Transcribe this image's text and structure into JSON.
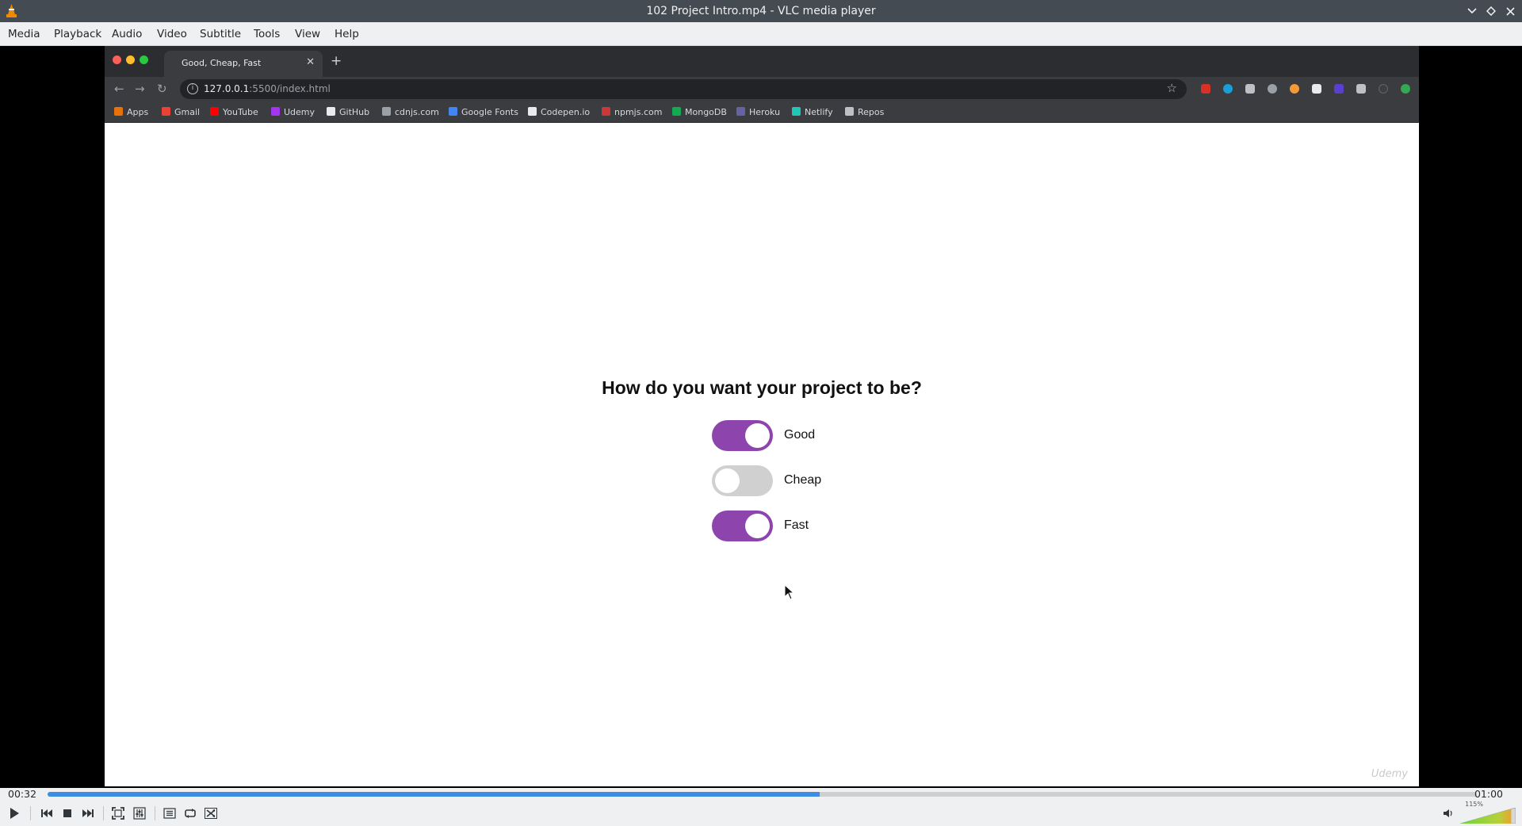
{
  "window": {
    "title": "102 Project Intro.mp4 - VLC media player",
    "app_icon": "vlc-cone-icon",
    "controls": [
      "chevron-down-icon",
      "restore-icon",
      "close-icon"
    ]
  },
  "menubar": {
    "items": [
      "Media",
      "Playback",
      "Audio",
      "Video",
      "Subtitle",
      "Tools",
      "View",
      "Help"
    ]
  },
  "browser": {
    "tab_title": "Good, Cheap, Fast",
    "url_host": "127.0.0.1",
    "url_rest": ":5500/index.html",
    "bookmarks": [
      {
        "label": "Apps",
        "color": "#e8710a"
      },
      {
        "label": "Gmail",
        "color": "#ea4335"
      },
      {
        "label": "YouTube",
        "color": "#ff0000"
      },
      {
        "label": "Udemy",
        "color": "#a435f0"
      },
      {
        "label": "GitHub",
        "color": "#e8eaed"
      },
      {
        "label": "cdnjs.com",
        "color": "#9aa0a6"
      },
      {
        "label": "Google Fonts",
        "color": "#4285f4"
      },
      {
        "label": "Codepen.io",
        "color": "#e8eaed"
      },
      {
        "label": "npmjs.com",
        "color": "#cb3837"
      },
      {
        "label": "MongoDB",
        "color": "#13aa52"
      },
      {
        "label": "Heroku",
        "color": "#6762a6"
      },
      {
        "label": "Netlify",
        "color": "#20c6b7"
      },
      {
        "label": "Repos",
        "color": "#bdc1c6"
      }
    ]
  },
  "page": {
    "question": "How do you want your project to be?",
    "toggles": [
      {
        "label": "Good",
        "on": true
      },
      {
        "label": "Cheap",
        "on": false
      },
      {
        "label": "Fast",
        "on": true
      }
    ],
    "accent_color": "#8e44ad",
    "off_color": "#d0d0d0",
    "watermark": "Udemy"
  },
  "player": {
    "elapsed": "00:32",
    "total": "01:00",
    "progress": 0.54,
    "volume_label": "115%",
    "volume": 1.15
  }
}
